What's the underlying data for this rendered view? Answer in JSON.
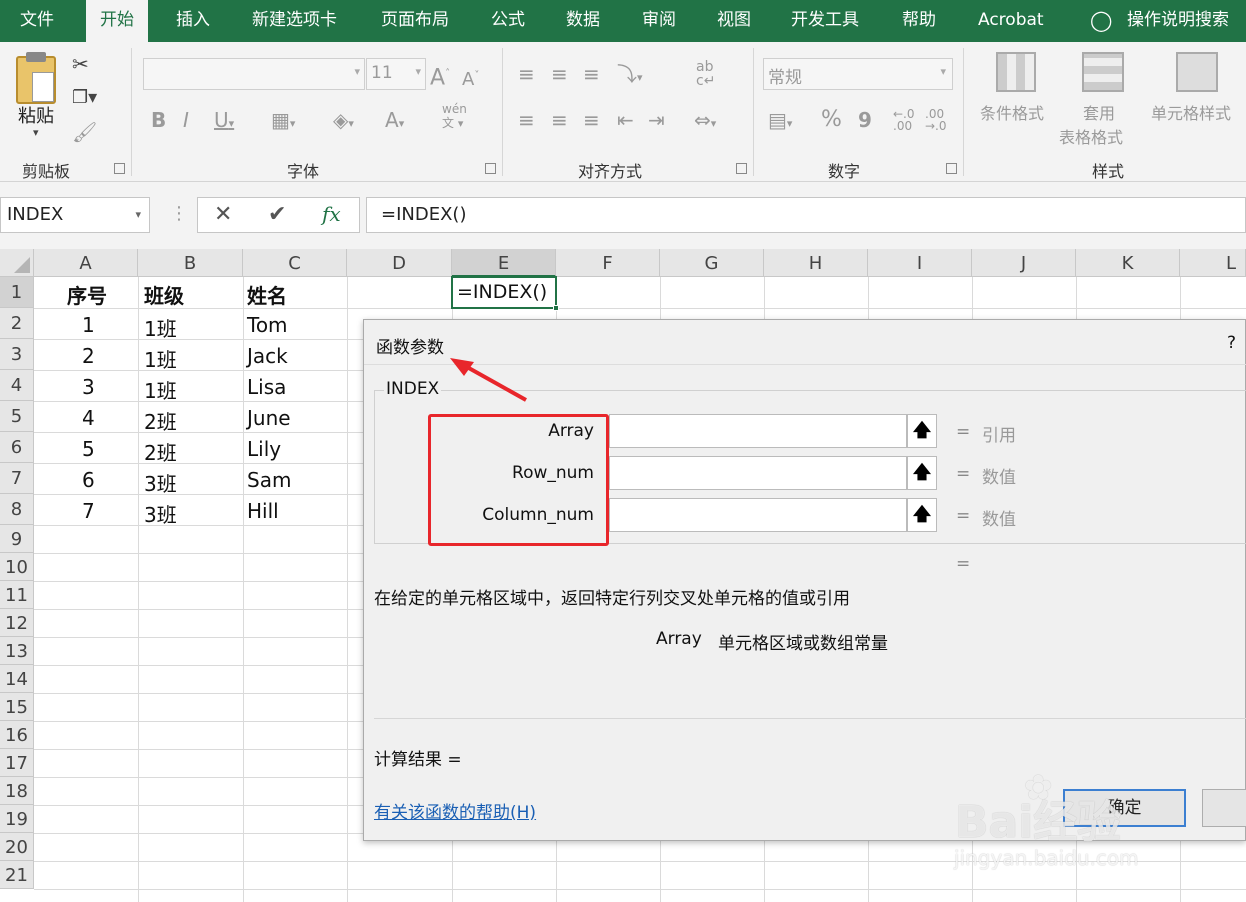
{
  "ribbon_tabs": [
    "文件",
    "开始",
    "插入",
    "新建选项卡",
    "页面布局",
    "公式",
    "数据",
    "审阅",
    "视图",
    "开发工具",
    "帮助",
    "Acrobat"
  ],
  "active_tab": "开始",
  "tell_me": "操作说明搜索",
  "ribbon": {
    "clipboard": {
      "paste": "粘贴",
      "label": "剪贴板"
    },
    "font": {
      "label": "字体",
      "size": "11",
      "phonetic": "wén"
    },
    "alignment": {
      "label": "对齐方式"
    },
    "number": {
      "label": "数字",
      "format": "常规",
      "percent": "%",
      "comma": "9",
      "inc": "←.0\n.00",
      "dec": ".00\n→.0"
    },
    "styles": {
      "label": "样式",
      "conditional": "条件格式",
      "table_line1": "套用",
      "table_line2": "表格格式",
      "cell_styles": "单元格样式"
    }
  },
  "name_box": "INDEX",
  "formula": "=INDEX()",
  "columns": [
    "A",
    "B",
    "C",
    "D",
    "E",
    "F",
    "G",
    "H",
    "I",
    "J",
    "K",
    "L"
  ],
  "rows": [
    "1",
    "2",
    "3",
    "4",
    "5",
    "6",
    "7",
    "8",
    "9",
    "10",
    "11",
    "12",
    "13",
    "14",
    "15",
    "16",
    "17",
    "18",
    "19",
    "20",
    "21"
  ],
  "cells": {
    "headers": [
      "序号",
      "班级",
      "姓名"
    ],
    "data": [
      [
        "1",
        "1班",
        "Tom"
      ],
      [
        "2",
        "1班",
        "Jack"
      ],
      [
        "3",
        "1班",
        "Lisa"
      ],
      [
        "4",
        "2班",
        "June"
      ],
      [
        "5",
        "2班",
        "Lily"
      ],
      [
        "6",
        "3班",
        "Sam"
      ],
      [
        "7",
        "3班",
        "Hill"
      ]
    ],
    "e1": "=INDEX()"
  },
  "dialog": {
    "title": "函数参数",
    "help_q": "?",
    "function_name": "INDEX",
    "args": [
      {
        "name": "Array",
        "value": "引用"
      },
      {
        "name": "Row_num",
        "value": "数值"
      },
      {
        "name": "Column_num",
        "value": "数值"
      }
    ],
    "eq": "=",
    "result_eq": "=",
    "description": "在给定的单元格区域中，返回特定行列交叉处单元格的值或引用",
    "arg_help_name": "Array",
    "arg_help_text": "单元格区域或数组常量",
    "calc_result": "计算结果 =",
    "help_link": "有关该函数的帮助(H)",
    "ok": "确定"
  },
  "watermark": {
    "brand": "Bai经验",
    "url": "jingyan.baidu.com"
  },
  "colors": {
    "excel_green": "#217346",
    "annotation_red": "#e8262b",
    "link_blue": "#1a5fb4"
  }
}
